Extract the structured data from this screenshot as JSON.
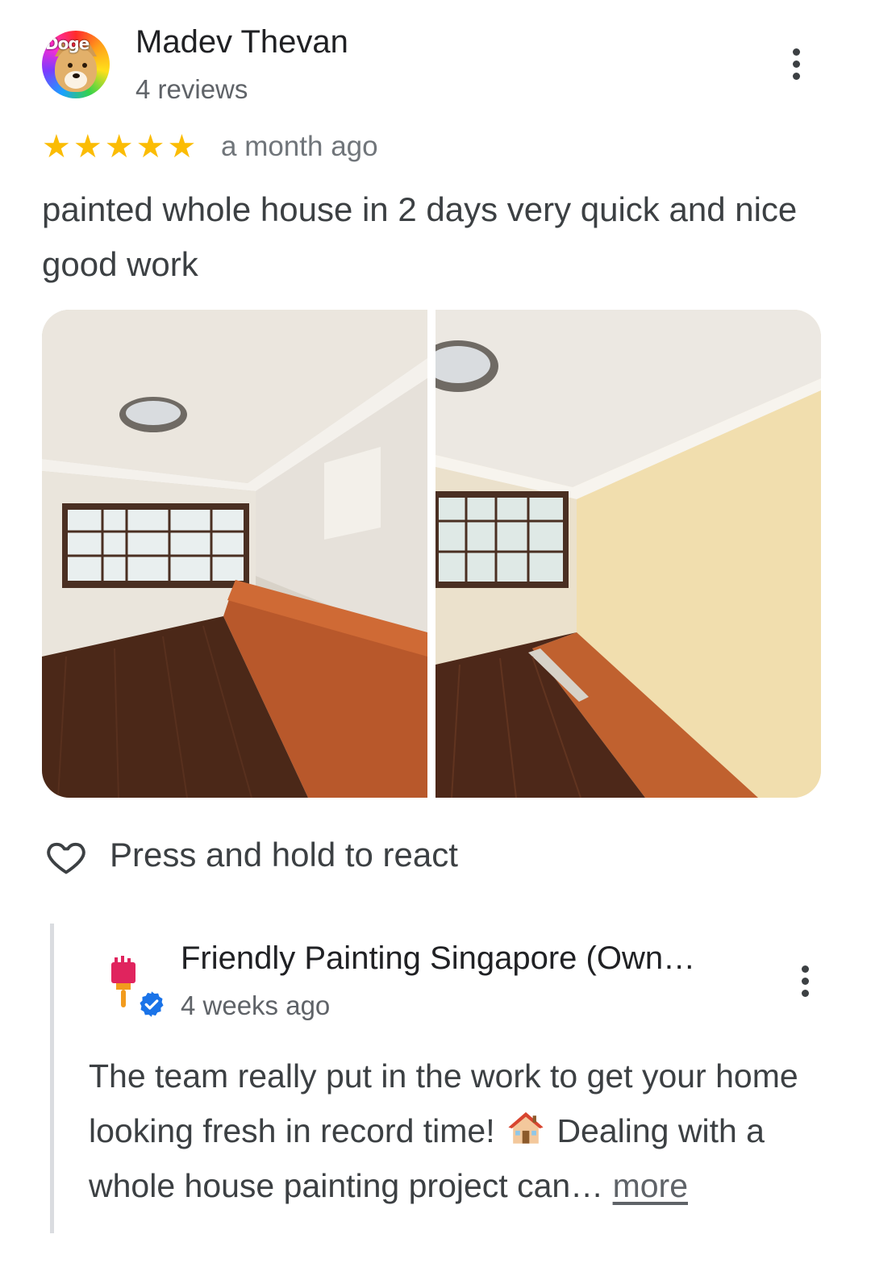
{
  "review": {
    "reviewer_name": "Madev Thevan",
    "reviewer_meta": "4 reviews",
    "avatar_text": "Doge",
    "rating": 5,
    "rating_stars": "★★★★★",
    "time": "a month ago",
    "text": "painted whole house in 2 days very quick and nice good work"
  },
  "photos": [
    {
      "icon": "room-photo-before"
    },
    {
      "icon": "room-photo-after"
    }
  ],
  "reaction": {
    "label": "Press and hold to react",
    "icon": "heart-icon"
  },
  "owner_reply": {
    "name": "Friendly Painting Singapore (Own…",
    "time": "4 weeks ago",
    "text_part1": "The team really put in the work to get your home looking fresh in record time!",
    "emoji": "house-emoji",
    "text_part2": "Dealing with a whole house painting project can…",
    "more_label": "more"
  },
  "colors": {
    "star": "#fbbc04",
    "verified": "#1a73e8",
    "text": "#3c4043"
  }
}
